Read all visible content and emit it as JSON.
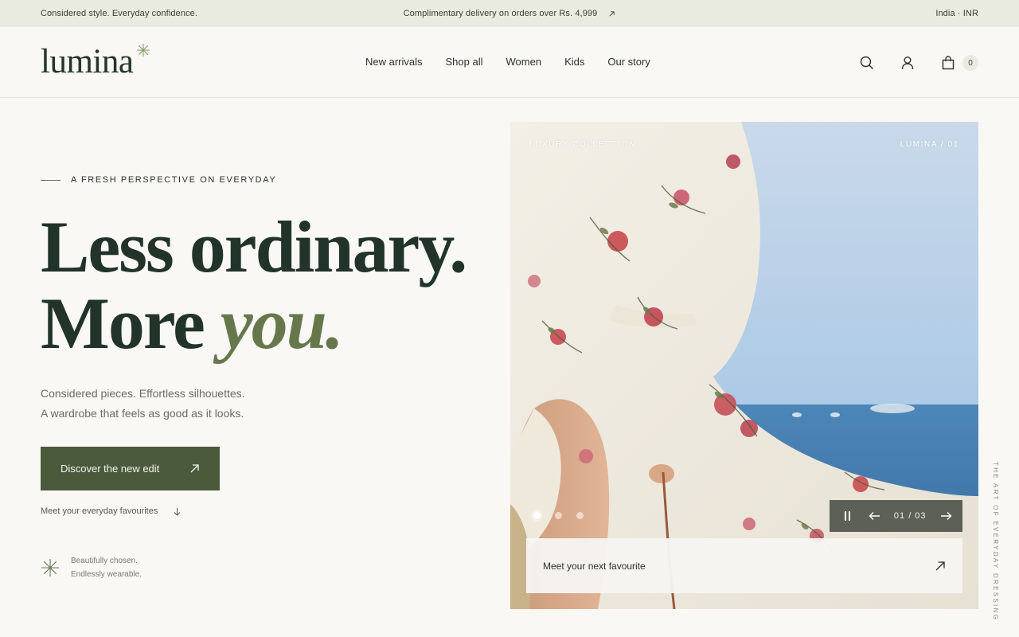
{
  "announcement": {
    "left": "Considered style. Everyday confidence.",
    "center": "Complimentary delivery on orders over Rs. 4,999",
    "right": "India · INR"
  },
  "brand": {
    "name": "lumina"
  },
  "nav": {
    "items": [
      {
        "label": "New arrivals"
      },
      {
        "label": "Shop all"
      },
      {
        "label": "Women"
      },
      {
        "label": "Kids"
      },
      {
        "label": "Our story"
      }
    ]
  },
  "header_icons": {
    "search": "search-icon",
    "account": "user-icon",
    "cart": "bag-icon",
    "cart_count": "0"
  },
  "hero": {
    "eyebrow": "A FRESH PERSPECTIVE ON EVERYDAY",
    "headline_line1": "Less ordinary.",
    "headline_line2_a": "More ",
    "headline_line2_b": "you.",
    "sub_line1": "Considered pieces. Effortless silhouettes.",
    "sub_line2": "A wardrobe that feels as good as it looks.",
    "cta_label": "Discover the new edit",
    "secondary_label": "Meet your everyday favourites",
    "badge_line1": "Beautifully chosen.",
    "badge_line2": "Endlessly wearable."
  },
  "slider": {
    "label_left": "LUXURY COLLECTION",
    "label_right": "LUMINA / 01",
    "counter": "01 / 03",
    "dots": 3,
    "active_dot": 1,
    "card_label": "Meet your next favourite"
  },
  "side_text": "THE ART OF EVERYDAY DRESSING",
  "colors": {
    "background": "#f9f8f5",
    "topbar": "#e9ebe1",
    "accent_green": "#4c5a3c",
    "headline": "#22342a",
    "italic_accent": "#67774c"
  }
}
